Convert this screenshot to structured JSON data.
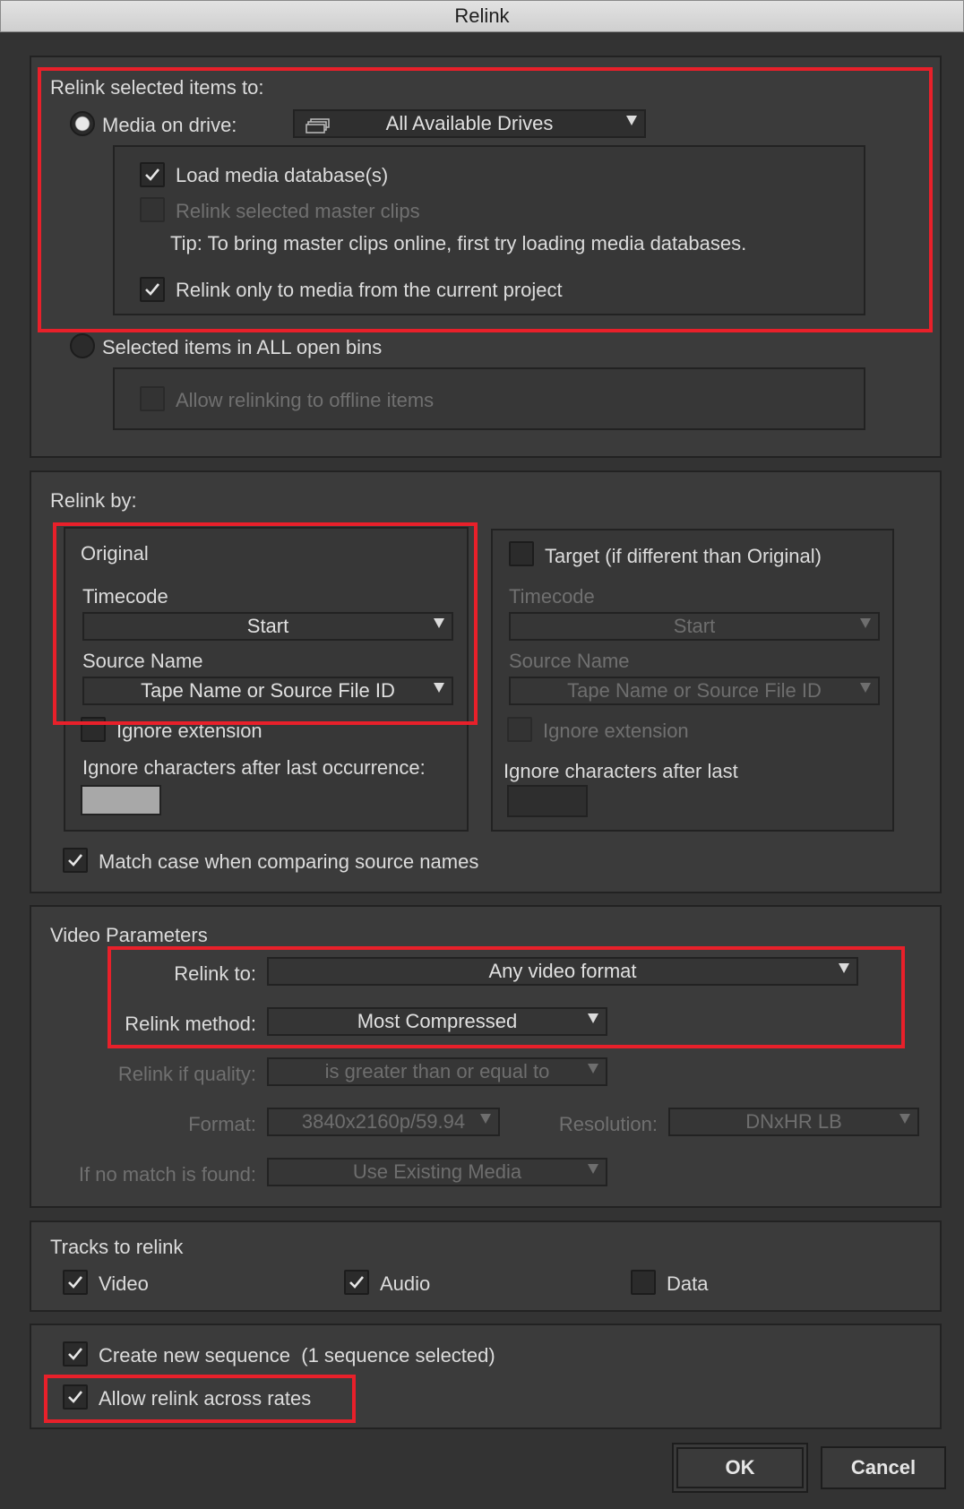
{
  "window": {
    "title": "Relink"
  },
  "relink_items": {
    "header": "Relink selected items to:",
    "media_on_drive": {
      "label": "Media on drive:",
      "selected": true
    },
    "drive_dropdown": {
      "value": "All Available Drives",
      "icon": "drive-stack-icon"
    },
    "load_media_db": {
      "label": "Load media database(s)",
      "checked": true
    },
    "relink_master_clips": {
      "label": "Relink selected master clips",
      "checked": false,
      "disabled": true
    },
    "tip": "Tip: To bring master clips online, first try loading media databases.",
    "relink_current_project": {
      "label": "Relink only to media from the current project",
      "checked": true
    },
    "selected_all_bins": {
      "label": "Selected items in ALL open bins",
      "selected": false
    },
    "allow_offline": {
      "label": "Allow relinking to offline items",
      "checked": false,
      "disabled": true
    }
  },
  "relink_by": {
    "header": "Relink by:",
    "original": {
      "title": "Original",
      "timecode_label": "Timecode",
      "timecode_value": "Start",
      "source_name_label": "Source Name",
      "source_name_value": "Tape Name or Source File ID",
      "ignore_extension": "Ignore extension",
      "ignore_chars": "Ignore characters after last occurrence:"
    },
    "target": {
      "title": "Target (if different than Original)",
      "checked": false,
      "timecode_label": "Timecode",
      "timecode_value": "Start",
      "source_name_label": "Source Name",
      "source_name_value": "Tape Name or Source File ID",
      "ignore_extension": "Ignore extension",
      "ignore_chars": "Ignore characters after last"
    },
    "match_case": {
      "label": "Match case when comparing source names",
      "checked": true
    }
  },
  "video_params": {
    "header": "Video Parameters",
    "relink_to_label": "Relink to:",
    "relink_to_value": "Any video format",
    "relink_method_label": "Relink method:",
    "relink_method_value": "Most Compressed",
    "quality_label": "Relink if quality:",
    "quality_value": "is greater than or equal to",
    "format_label": "Format:",
    "format_value": "3840x2160p/59.94",
    "resolution_label": "Resolution:",
    "resolution_value": "DNxHR LB",
    "no_match_label": "If no match is found:",
    "no_match_value": "Use Existing Media"
  },
  "tracks": {
    "header": "Tracks to relink",
    "video": {
      "label": "Video",
      "checked": true
    },
    "audio": {
      "label": "Audio",
      "checked": true
    },
    "data": {
      "label": "Data",
      "checked": false
    }
  },
  "options": {
    "create_sequence": {
      "label": "Create new sequence  (1 sequence selected)",
      "checked": true
    },
    "allow_rates": {
      "label": "Allow relink across rates",
      "checked": true
    }
  },
  "buttons": {
    "ok": "OK",
    "cancel": "Cancel"
  },
  "colors": {
    "highlight": "#e8202a",
    "background": "#333333"
  }
}
